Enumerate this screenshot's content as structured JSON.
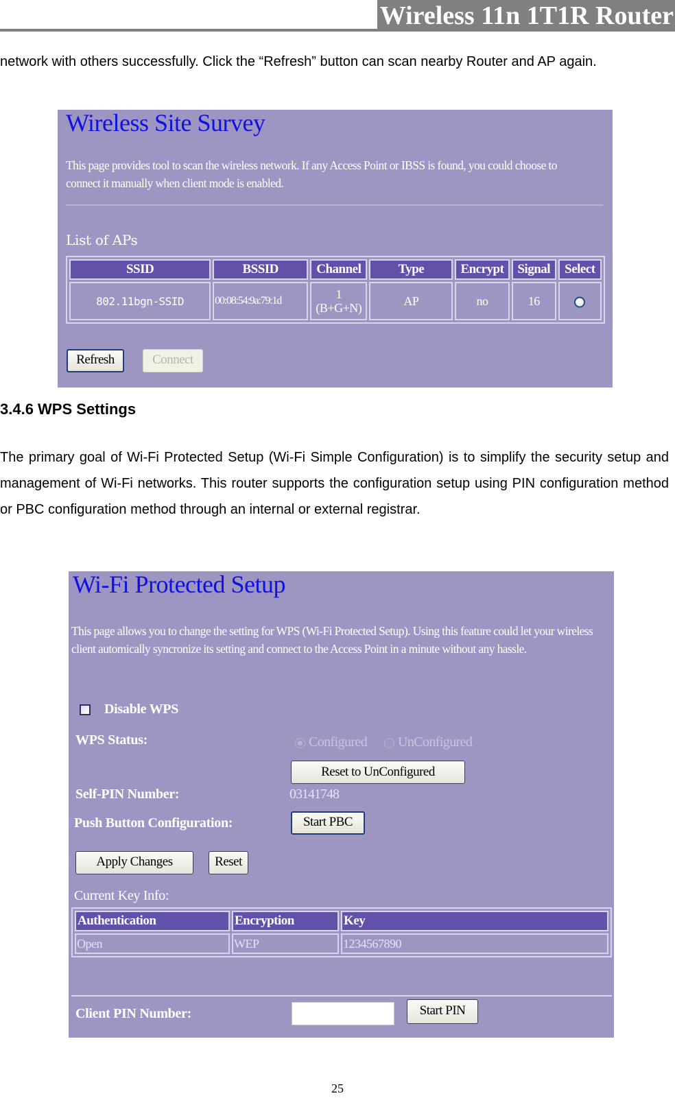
{
  "header": {
    "title": "Wireless 11n 1T1R Router"
  },
  "intro_paragraph": "network with others successfully. Click the “Refresh” button can scan nearby Router and AP again.",
  "site_survey": {
    "title": "Wireless Site Survey",
    "description": "This page provides tool to scan the wireless network. If any Access Point or IBSS is found, you could choose to connect it manually when client mode is enabled.",
    "list_heading": "List of APs",
    "columns": [
      "SSID",
      "BSSID",
      "Channel",
      "Type",
      "Encrypt",
      "Signal",
      "Select"
    ],
    "rows": [
      {
        "ssid": "802.11bgn-SSID",
        "bssid": "00:08:54:9a:79:1d",
        "channel_line1": "1",
        "channel_line2": "(B+G+N)",
        "type": "AP",
        "encrypt": "no",
        "signal": "16",
        "selected": false
      }
    ],
    "refresh_label": "Refresh",
    "connect_label": "Connect"
  },
  "section": {
    "heading": "3.4.6 WPS Settings",
    "paragraph": "The primary goal of Wi-Fi Protected Setup (Wi-Fi Simple Configuration) is to simplify the security setup and management of Wi-Fi networks. This router supports the configuration setup using PIN configuration method or PBC configuration method through an internal or external registrar."
  },
  "wps": {
    "title": "Wi-Fi Protected Setup",
    "description": "This page allows you to change the setting for WPS (Wi-Fi Protected Setup). Using this feature could let your wireless client automically syncronize its setting and connect to the Access Point in a minute without any hassle.",
    "disable_label": "Disable WPS",
    "disable_checked": false,
    "status_label": "WPS Status:",
    "status_options": [
      "Configured",
      "UnConfigured"
    ],
    "status_selected": "Configured",
    "reset_unconfigured_label": "Reset to UnConfigured",
    "self_pin_label": "Self-PIN Number:",
    "self_pin_value": "03141748",
    "pbc_label": "Push Button Configuration:",
    "start_pbc_label": "Start PBC",
    "apply_label": "Apply Changes",
    "reset_label": "Reset",
    "key_info_label": "Current Key Info:",
    "key_columns": [
      "Authentication",
      "Encryption",
      "Key"
    ],
    "key_rows": [
      {
        "authentication": "Open",
        "encryption": "WEP",
        "key": "1234567890"
      }
    ],
    "client_pin_label": "Client PIN Number:",
    "client_pin_value": "",
    "start_pin_label": "Start PIN"
  },
  "footer": {
    "page_number": "25"
  }
}
